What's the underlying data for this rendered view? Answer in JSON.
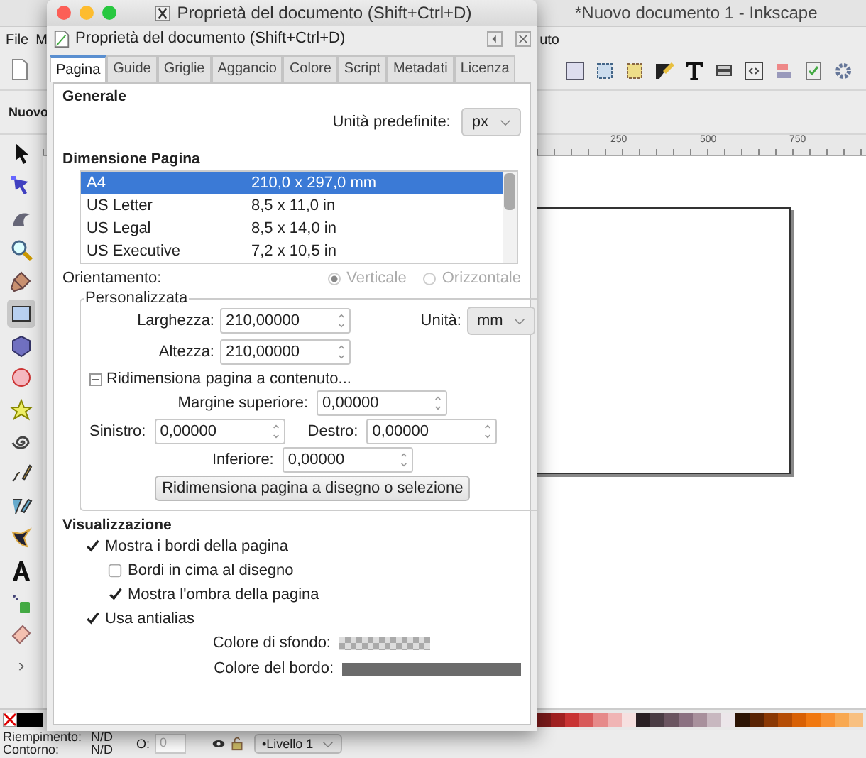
{
  "app": {
    "title": "*Nuovo documento 1 - Inkscape",
    "menu_left": [
      "File",
      "M"
    ],
    "menu_right": "uto",
    "tool_controls_label": "Nuovo",
    "tools": [
      {
        "kind": "arrow",
        "selected": false
      },
      {
        "kind": "node",
        "selected": false
      },
      {
        "kind": "tweak",
        "selected": false
      },
      {
        "kind": "zoom",
        "selected": false
      },
      {
        "kind": "measure",
        "selected": false
      },
      {
        "kind": "rect",
        "selected": true
      },
      {
        "kind": "box",
        "selected": false
      },
      {
        "kind": "circle",
        "selected": false
      },
      {
        "kind": "star",
        "selected": false
      },
      {
        "kind": "spiral",
        "selected": false
      },
      {
        "kind": "pencil",
        "selected": false
      },
      {
        "kind": "pen",
        "selected": false
      },
      {
        "kind": "calligraphy",
        "selected": false
      },
      {
        "kind": "text",
        "selected": false
      },
      {
        "kind": "spray",
        "selected": false
      },
      {
        "kind": "eraser",
        "selected": false
      }
    ],
    "more_tools": "›",
    "ruler_labels": [
      "250",
      "500",
      "750"
    ],
    "palette": [
      {
        "color": "#000000"
      },
      {
        "color": "#7a1a1a"
      },
      {
        "color": "#a02020"
      },
      {
        "color": "#c83232"
      },
      {
        "color": "#d85a5a"
      },
      {
        "color": "#e68a8a"
      },
      {
        "color": "#f0b4b4"
      },
      {
        "color": "#f6e0e0"
      },
      {
        "color": "#2a2024"
      },
      {
        "color": "#4a3c44"
      },
      {
        "color": "#6a5460"
      },
      {
        "color": "#8a7080"
      },
      {
        "color": "#a8909c"
      },
      {
        "color": "#c8b8c0"
      },
      {
        "color": "#ece6ea"
      },
      {
        "color": "#2c1404"
      },
      {
        "color": "#5a2404"
      },
      {
        "color": "#8a3804"
      },
      {
        "color": "#b44c04"
      },
      {
        "color": "#d86004"
      },
      {
        "color": "#f07810"
      },
      {
        "color": "#f89030"
      },
      {
        "color": "#f8a850"
      },
      {
        "color": "#f8c080"
      }
    ],
    "status": {
      "fill_label": "Riempimento:",
      "fill_value": "N/D",
      "stroke_label": "Contorno:",
      "stroke_value": "N/D",
      "opacity_label": "O:",
      "opacity_value": "0",
      "layer": "•Livello 1"
    }
  },
  "dialog": {
    "title": "Proprietà del documento (Shift+Ctrl+D)",
    "header": "Proprietà del documento (Shift+Ctrl+D)",
    "tabs": [
      {
        "label": "Pagina",
        "selected": true
      },
      {
        "label": "Guide",
        "selected": false
      },
      {
        "label": "Griglie",
        "selected": false
      },
      {
        "label": "Aggancio",
        "selected": false
      },
      {
        "label": "Colore",
        "selected": false
      },
      {
        "label": "Script",
        "selected": false
      },
      {
        "label": "Metadati",
        "selected": false
      },
      {
        "label": "Licenza",
        "selected": false
      }
    ],
    "general": {
      "heading": "Generale",
      "unit_label": "Unità predefinite:",
      "unit_value": "px"
    },
    "page_size": {
      "heading": "Dimensione Pagina",
      "rows": [
        {
          "name": "A4",
          "size": "210,0 x 297,0 mm",
          "selected": true
        },
        {
          "name": "US Letter",
          "size": "8,5 x 11,0 in",
          "selected": false
        },
        {
          "name": "US Legal",
          "size": "8,5 x 14,0 in",
          "selected": false
        },
        {
          "name": "US Executive",
          "size": "7,2 x 10,5 in",
          "selected": false
        }
      ]
    },
    "orientation": {
      "label": "Orientamento:",
      "disabled": true,
      "options": [
        {
          "label": "Verticale",
          "selected": true
        },
        {
          "label": "Orizzontale",
          "selected": false
        }
      ]
    },
    "custom": {
      "heading": "Personalizzata",
      "width_label": "Larghezza:",
      "width_value": "210,00000",
      "unit_label": "Unità:",
      "unit_value": "mm",
      "height_label": "Altezza:",
      "height_value": "210,00000",
      "resize": {
        "label": "Ridimensiona pagina a contenuto...",
        "expanded": true,
        "top_label": "Margine superiore:",
        "top_value": "0,00000",
        "left_label": "Sinistro:",
        "left_value": "0,00000",
        "right_label": "Destro:",
        "right_value": "0,00000",
        "bottom_label": "Inferiore:",
        "bottom_value": "0,00000",
        "button": "Ridimensiona pagina a disegno o selezione"
      }
    },
    "display": {
      "heading": "Visualizzazione",
      "checks": [
        {
          "label": "Mostra i bordi della pagina",
          "checked": true,
          "children": [
            {
              "label": "Bordi in cima al disegno",
              "checked": false
            },
            {
              "label": "Mostra l'ombra della pagina",
              "checked": true
            }
          ]
        },
        {
          "label": "Usa antialias",
          "checked": true
        }
      ],
      "colors": [
        {
          "label": "Colore di sfondo:",
          "kind": "checker"
        },
        {
          "label": "Colore del bordo:",
          "kind": "solid"
        }
      ]
    }
  }
}
